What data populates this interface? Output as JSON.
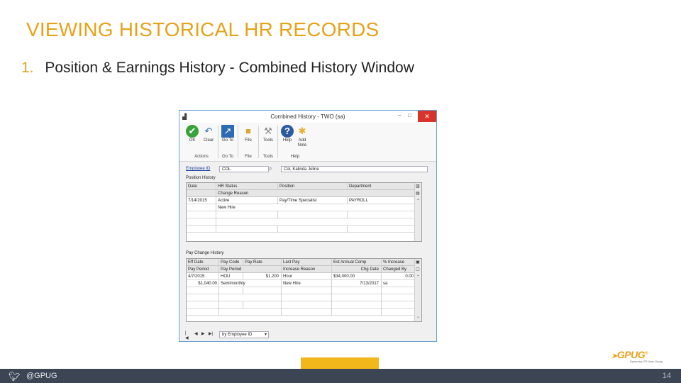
{
  "slide": {
    "title": "VIEWING HISTORICAL HR RECORDS",
    "bullet_number": "1.",
    "bullet_text": "Position & Earnings History - Combined History Window",
    "footer_handle": "@GPUG",
    "page_number": "14",
    "logo_text": "GPUG",
    "logo_reg": "®",
    "logo_tagline": "Dynamics GP User Group"
  },
  "window": {
    "title": "Combined History - TWO (sa)",
    "controls": {
      "minimize": "–",
      "maximize": "□",
      "close": "✕"
    },
    "ribbon": {
      "buttons": [
        {
          "label": "OK",
          "icon": "check-icon"
        },
        {
          "label": "Clear",
          "icon": "undo-icon"
        },
        {
          "label": "Go To",
          "icon": "goto-icon"
        },
        {
          "label": "File",
          "icon": "folder-icon"
        },
        {
          "label": "Tools",
          "icon": "tools-icon"
        },
        {
          "label": "Help",
          "icon": "help-icon"
        },
        {
          "label": "Add Note",
          "icon": "note-icon"
        }
      ],
      "groups": [
        "Actions",
        "Go To",
        "File",
        "Tools",
        "Help"
      ]
    },
    "employee": {
      "label": "Employee ID",
      "id_value": "COL",
      "name_value": "Col, Kalinda Joline"
    },
    "position_history": {
      "label": "Position History",
      "headers": [
        "Date",
        "HR Status",
        "Position",
        "Department"
      ],
      "subheader": "Change Reason",
      "rows": [
        {
          "date": "7/14/2015",
          "status": "Active",
          "position": "Pay/Time Specialist",
          "department": "PAYROLL"
        }
      ],
      "reason": "New Hire"
    },
    "pay_change_history": {
      "label": "Pay Change History",
      "headers": [
        "Eff Date",
        "Pay Code",
        "Pay Rate",
        "Last Pay",
        "Est Annual Comp",
        "% Increase"
      ],
      "subheaders": [
        "Pay Period",
        "Pay Period",
        "Increase Reason",
        "Chg Date",
        "Changed By"
      ],
      "row1": [
        "4/7/2015",
        "HOU",
        "$1.200",
        "Hour",
        "$34,000.00",
        "0.00"
      ],
      "row2": [
        "$1,040.00",
        "Semimonthly",
        "New Hire",
        "7/13/2017",
        "sa"
      ]
    },
    "navigation": {
      "sort_value": "by Employee ID"
    }
  }
}
